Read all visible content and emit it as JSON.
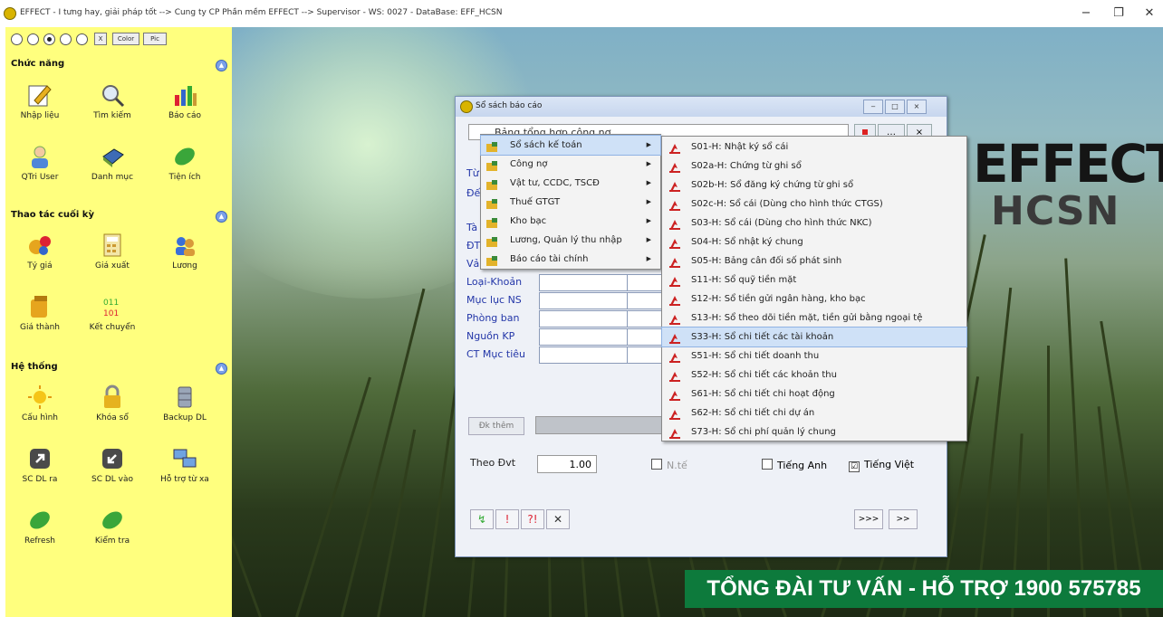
{
  "window": {
    "title": "EFFECT - I tưng hay, giải pháp tốt --> Cung ty CP Phần mềm EFFECT --> Supervisor  -  WS: 0027  -  DataBase: EFF_HCSN",
    "minimize": "−",
    "restore": "❐",
    "close": "✕"
  },
  "toolbar": {
    "color_label": "Color",
    "pic_label": "Pic",
    "x_label": "X"
  },
  "sections": [
    {
      "title": "Chức năng",
      "items": [
        {
          "label": "Nhập liệu",
          "icon": "pencil-icon"
        },
        {
          "label": "Tìm kiếm",
          "icon": "magnifier-icon"
        },
        {
          "label": "Báo cáo",
          "icon": "chart-icon"
        },
        {
          "label": "QTri User",
          "icon": "user-icon"
        },
        {
          "label": "Danh mục",
          "icon": "book-icon"
        },
        {
          "label": "Tiện ích",
          "icon": "leaf-icon"
        }
      ]
    },
    {
      "title": "Thao tác cuối kỳ",
      "items": [
        {
          "label": "Tỷ giá",
          "icon": "currency-icon"
        },
        {
          "label": "Giá xuất",
          "icon": "calculator-icon"
        },
        {
          "label": "Lương",
          "icon": "people-icon"
        },
        {
          "label": "Giá thành",
          "icon": "cost-icon"
        },
        {
          "label": "Kết chuyển",
          "icon": "transfer-icon"
        }
      ]
    },
    {
      "title": "Hệ thống",
      "items": [
        {
          "label": "Cấu hình",
          "icon": "sun-icon"
        },
        {
          "label": "Khóa sổ",
          "icon": "lock-icon"
        },
        {
          "label": "Backup DL",
          "icon": "database-icon"
        },
        {
          "label": "SC DL ra",
          "icon": "export-icon"
        },
        {
          "label": "SC DL vào",
          "icon": "import-icon"
        },
        {
          "label": "Hỗ trợ từ xa",
          "icon": "remote-icon"
        },
        {
          "label": "Refresh",
          "icon": "leaf-icon"
        },
        {
          "label": "Kiểm tra",
          "icon": "leaf-icon"
        }
      ]
    }
  ],
  "brand": {
    "line1": "EFFECT",
    "line2": "HCSN"
  },
  "hotline": "TỔNG ĐÀI TƯ VẤN - HỖ TRỢ 1900 575785",
  "dialog": {
    "title": "Sổ sách báo cáo",
    "report_selected": "Bảng tổng hợp công nợ",
    "combo_arrow": "…",
    "close_x": "×",
    "partial_labels": [
      "Từ",
      "Đế",
      "Tà",
      "ĐT",
      "Vả"
    ],
    "field_labels": [
      "Loại-Khoản",
      "Mục lục NS",
      "Phòng ban",
      "Nguồn KP",
      "CT Mục tiêu"
    ],
    "dk_button": "Đk thêm",
    "theo_label": "Theo Đvt",
    "theo_value": "1.00",
    "nte_label": "N.tế",
    "tieng_anh": "Tiếng Anh",
    "tieng_viet": "Tiếng Việt",
    "tieng_viet_checked": "☑",
    "actions": [
      "↯",
      "!",
      "?!",
      "✕"
    ],
    "nav_next_all": ">>>",
    "nav_next": ">>"
  },
  "menu_categories": [
    {
      "label": "Sổ sách kế toán",
      "highlight": true
    },
    {
      "label": "Công nợ"
    },
    {
      "label": "Vật tư, CCDC, TSCĐ"
    },
    {
      "label": "Thuế GTGT"
    },
    {
      "label": "Kho bạc"
    },
    {
      "label": "Lương, Quản lý thu nhập"
    },
    {
      "label": "Báo cáo tài chính"
    }
  ],
  "menu_reports": [
    "S01-H: Nhật ký sổ cái",
    "S02a-H: Chứng từ ghi sổ",
    "S02b-H: Sổ đăng ký chứng từ ghi sổ",
    "S02c-H: Sổ cái (Dùng cho hình thức CTGS)",
    "S03-H: Sổ cái (Dùng cho hình thức NKC)",
    "S04-H: Sổ nhật ký chung",
    "S05-H: Bảng cân đối số phát sinh",
    "S11-H: Sổ quỹ tiền mặt",
    "S12-H: Sổ tiền gửi ngân hàng, kho bạc",
    "S13-H: Sổ theo dõi tiền mặt, tiền gửi bằng ngoại tệ",
    "S33-H: Sổ chi tiết các tài khoản",
    "S51-H: Sổ chi tiết doanh thu",
    "S52-H: Sổ chi tiết các khoản thu",
    "S61-H: Sổ chi tiết chi hoạt động",
    "S62-H: Sổ chi tiết chi dự án",
    "S73-H: Sổ chi phí quản lý chung"
  ],
  "menu_reports_highlight_index": 10,
  "colors": {
    "panel_bg": "#ffff7e",
    "hotline_bg": "#0d7a3c",
    "label_blue": "#2336a8",
    "highlight": "#cfe1f7"
  }
}
